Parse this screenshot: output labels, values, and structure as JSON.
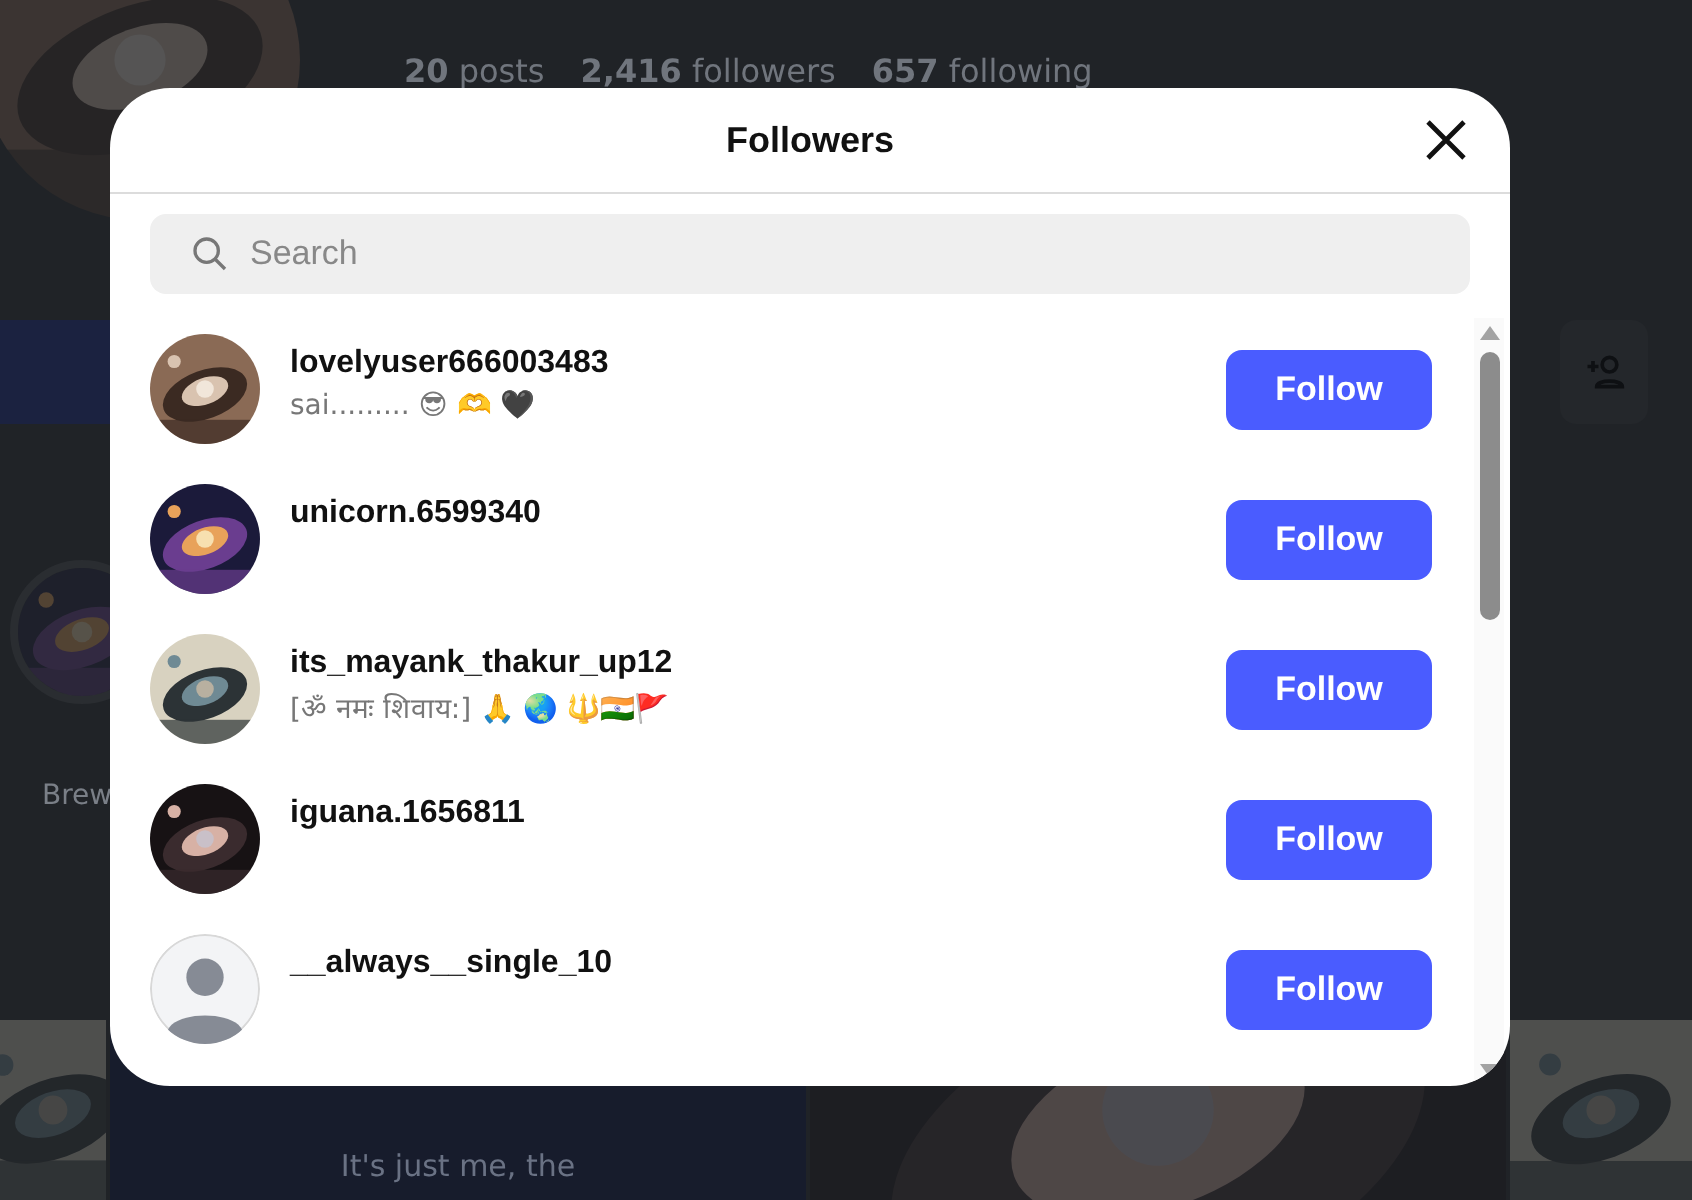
{
  "profile": {
    "stats": [
      "**20** posts",
      "**2,416** followers",
      "**657** following"
    ],
    "story_label": "Brew",
    "post_caption": "It's just me, the"
  },
  "dialog": {
    "title": "Followers",
    "search": {
      "placeholder": "Search"
    },
    "followers": [
      {
        "username": "lovelyuser666003483",
        "bio": "sai......... 😎 🫶 🖤",
        "button": "Follow"
      },
      {
        "username": "unicorn.6599340",
        "button": "Follow"
      },
      {
        "username": "its_mayank_thakur_up12",
        "bio": "[ॐ नमः शिवाय:]  🙏 🌏 🔱🇮🇳🚩",
        "button": "Follow"
      },
      {
        "username": "iguana.1656811",
        "button": "Follow"
      },
      {
        "kind": "default",
        "username": "__always__single_10",
        "button": "Follow"
      }
    ]
  }
}
